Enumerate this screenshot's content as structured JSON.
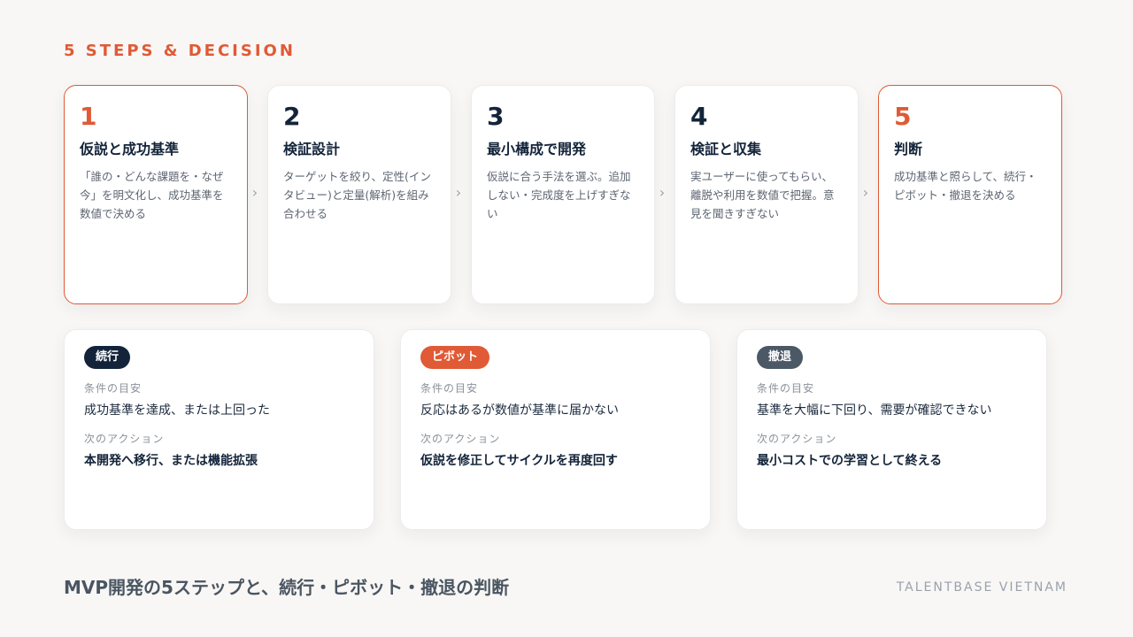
{
  "section_label": "5 STEPS & DECISION",
  "steps": [
    {
      "number": "1",
      "title": "仮説と成功基準",
      "desc": "「誰の・どんな課題を・なぜ今」を明文化し、成功基準を数値で決める"
    },
    {
      "number": "2",
      "title": "検証設計",
      "desc": "ターゲットを絞り、定性(インタビュー)と定量(解析)を組み合わせる"
    },
    {
      "number": "3",
      "title": "最小構成で開発",
      "desc": "仮説に合う手法を選ぶ。追加しない・完成度を上げすぎない"
    },
    {
      "number": "4",
      "title": "検証と収集",
      "desc": "実ユーザーに使ってもらい、離脱や利用を数値で把握。意見を聞きすぎない"
    },
    {
      "number": "5",
      "title": "判断",
      "desc": "成功基準と照らして、続行・ピボット・撤退を決める"
    }
  ],
  "arrow_glyph": "›",
  "decisions": [
    {
      "badge": "続行",
      "badge_color": "#13243a",
      "condition_label": "条件の目安",
      "condition": "成功基準を達成、または上回った",
      "action_label": "次のアクション",
      "action": "本開発へ移行、または機能拡張"
    },
    {
      "badge": "ピボット",
      "badge_color": "#e05a35",
      "condition_label": "条件の目安",
      "condition": "反応はあるが数値が基準に届かない",
      "action_label": "次のアクション",
      "action": "仮説を修正してサイクルを再度回す"
    },
    {
      "badge": "撤退",
      "badge_color": "#4b5866",
      "condition_label": "条件の目安",
      "condition": "基準を大幅に下回り、需要が確認できない",
      "action_label": "次のアクション",
      "action": "最小コストでの学習として終える"
    }
  ],
  "footer": {
    "title": "MVP開発の5ステップと、続行・ピボット・撤退の判断",
    "brand": "TALENTBASE VIETNAM"
  },
  "colors": {
    "accent": "#e05a35",
    "navy": "#13243a",
    "slate": "#4b5866",
    "background": "#f8f7f5"
  }
}
